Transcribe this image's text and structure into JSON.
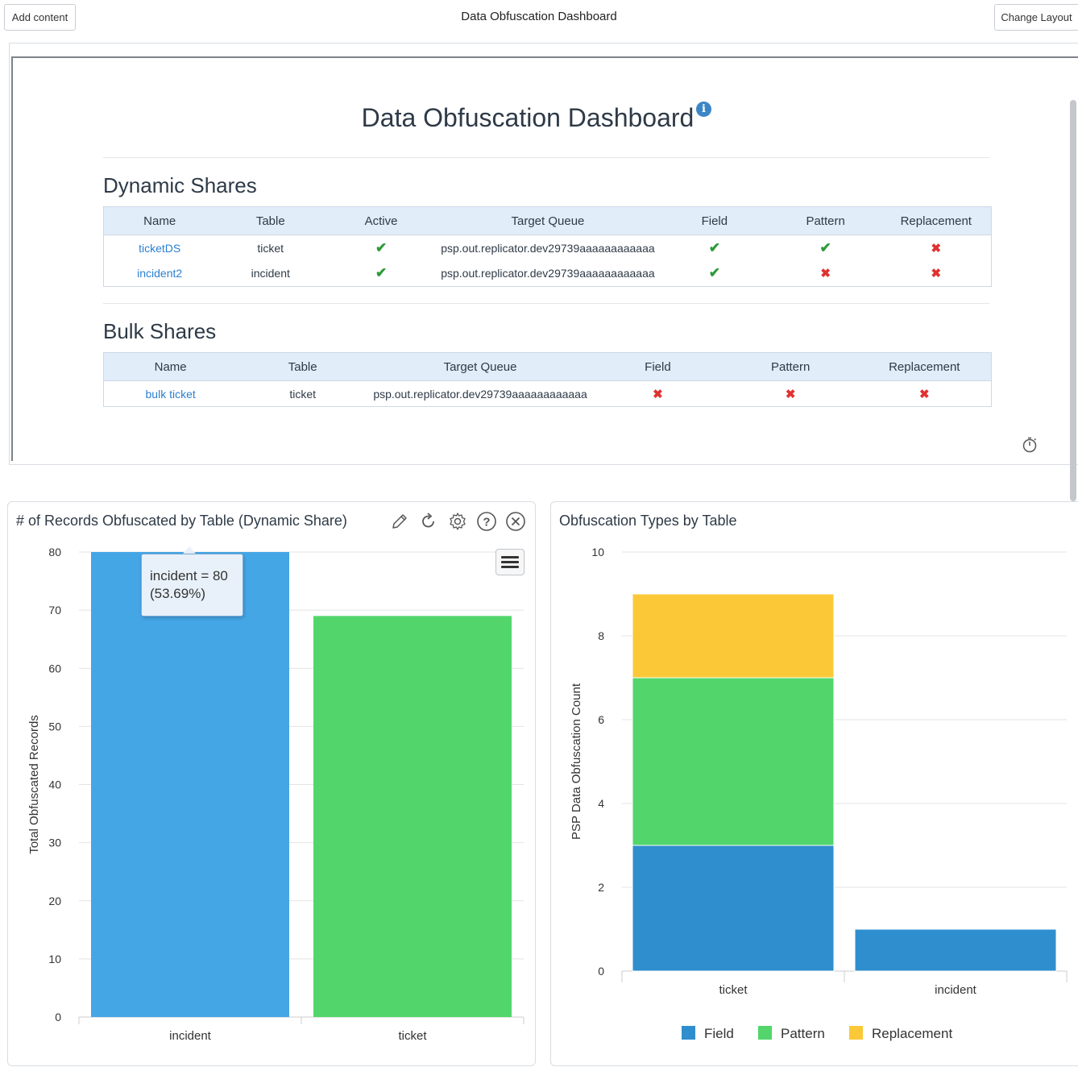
{
  "topbar": {
    "add_content_label": "Add content",
    "title": "Data Obfuscation Dashboard",
    "change_layout_label": "Change Layout"
  },
  "main": {
    "title": "Data Obfuscation Dashboard",
    "info_glyph": "i",
    "dynamic": {
      "title": "Dynamic Shares",
      "headers": [
        "Name",
        "Table",
        "Active",
        "Target Queue",
        "Field",
        "Pattern",
        "Replacement"
      ],
      "rows": [
        {
          "name": "ticketDS",
          "table": "ticket",
          "active": true,
          "queue": "psp.out.replicator.dev29739aaaaaaaaaaaa",
          "field": true,
          "pattern": true,
          "replacement": false
        },
        {
          "name": "incident2",
          "table": "incident",
          "active": true,
          "queue": "psp.out.replicator.dev29739aaaaaaaaaaaa",
          "field": true,
          "pattern": false,
          "replacement": false
        }
      ]
    },
    "bulk": {
      "title": "Bulk Shares",
      "headers": [
        "Name",
        "Table",
        "Target Queue",
        "Field",
        "Pattern",
        "Replacement"
      ],
      "rows": [
        {
          "name": "bulk ticket",
          "table": "ticket",
          "queue": "psp.out.replicator.dev29739aaaaaaaaaaaa",
          "field": false,
          "pattern": false,
          "replacement": false
        }
      ]
    }
  },
  "glyphs": {
    "check": "✔",
    "cross": "✖"
  },
  "left_panel": {
    "title": "# of Records Obfuscated by Table (Dynamic Share)",
    "tooltip_line1": "incident = 80",
    "tooltip_line2": "(53.69%)"
  },
  "right_panel": {
    "title": "Obfuscation Types by Table"
  },
  "colors": {
    "blue_bar": "#45a6e6",
    "green_bar": "#52d66b",
    "field": "#2f8ecd",
    "pattern": "#52d66b",
    "replacement": "#fbc938"
  },
  "chart_data": [
    {
      "type": "bar",
      "categories": [
        "incident",
        "ticket"
      ],
      "values": [
        80,
        69
      ],
      "title": "# of Records Obfuscated by Table (Dynamic Share)",
      "xlabel": "",
      "ylabel": "Total Obfuscated Records",
      "ylim": [
        0,
        80
      ],
      "yticks": [
        0,
        10,
        20,
        30,
        40,
        50,
        60,
        70,
        80
      ],
      "grid": true
    },
    {
      "type": "bar",
      "stacked": true,
      "categories": [
        "ticket",
        "incident"
      ],
      "series": [
        {
          "name": "Field",
          "values": [
            3,
            1
          ]
        },
        {
          "name": "Pattern",
          "values": [
            4,
            0
          ]
        },
        {
          "name": "Replacement",
          "values": [
            2,
            0
          ]
        }
      ],
      "title": "Obfuscation Types by Table",
      "xlabel": "",
      "ylabel": "PSP Data Obfuscation Count",
      "ylim": [
        0,
        10
      ],
      "yticks": [
        0,
        2,
        4,
        6,
        8,
        10
      ],
      "grid": true,
      "legend": "bottom"
    }
  ]
}
